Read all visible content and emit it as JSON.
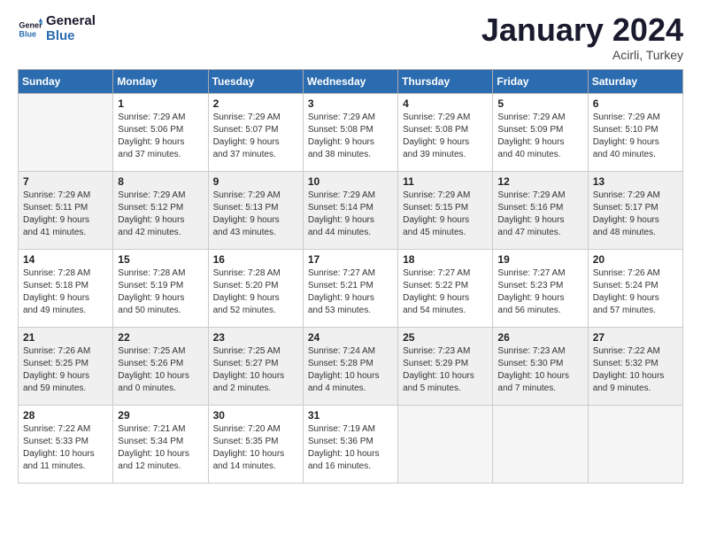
{
  "logo": {
    "text_general": "General",
    "text_blue": "Blue"
  },
  "header": {
    "month": "January 2024",
    "location": "Acirli, Turkey"
  },
  "weekdays": [
    "Sunday",
    "Monday",
    "Tuesday",
    "Wednesday",
    "Thursday",
    "Friday",
    "Saturday"
  ],
  "weeks": [
    [
      {
        "day": null,
        "lines": []
      },
      {
        "day": "1",
        "lines": [
          "Sunrise: 7:29 AM",
          "Sunset: 5:06 PM",
          "Daylight: 9 hours",
          "and 37 minutes."
        ]
      },
      {
        "day": "2",
        "lines": [
          "Sunrise: 7:29 AM",
          "Sunset: 5:07 PM",
          "Daylight: 9 hours",
          "and 37 minutes."
        ]
      },
      {
        "day": "3",
        "lines": [
          "Sunrise: 7:29 AM",
          "Sunset: 5:08 PM",
          "Daylight: 9 hours",
          "and 38 minutes."
        ]
      },
      {
        "day": "4",
        "lines": [
          "Sunrise: 7:29 AM",
          "Sunset: 5:08 PM",
          "Daylight: 9 hours",
          "and 39 minutes."
        ]
      },
      {
        "day": "5",
        "lines": [
          "Sunrise: 7:29 AM",
          "Sunset: 5:09 PM",
          "Daylight: 9 hours",
          "and 40 minutes."
        ]
      },
      {
        "day": "6",
        "lines": [
          "Sunrise: 7:29 AM",
          "Sunset: 5:10 PM",
          "Daylight: 9 hours",
          "and 40 minutes."
        ]
      }
    ],
    [
      {
        "day": "7",
        "lines": [
          "Sunrise: 7:29 AM",
          "Sunset: 5:11 PM",
          "Daylight: 9 hours",
          "and 41 minutes."
        ]
      },
      {
        "day": "8",
        "lines": [
          "Sunrise: 7:29 AM",
          "Sunset: 5:12 PM",
          "Daylight: 9 hours",
          "and 42 minutes."
        ]
      },
      {
        "day": "9",
        "lines": [
          "Sunrise: 7:29 AM",
          "Sunset: 5:13 PM",
          "Daylight: 9 hours",
          "and 43 minutes."
        ]
      },
      {
        "day": "10",
        "lines": [
          "Sunrise: 7:29 AM",
          "Sunset: 5:14 PM",
          "Daylight: 9 hours",
          "and 44 minutes."
        ]
      },
      {
        "day": "11",
        "lines": [
          "Sunrise: 7:29 AM",
          "Sunset: 5:15 PM",
          "Daylight: 9 hours",
          "and 45 minutes."
        ]
      },
      {
        "day": "12",
        "lines": [
          "Sunrise: 7:29 AM",
          "Sunset: 5:16 PM",
          "Daylight: 9 hours",
          "and 47 minutes."
        ]
      },
      {
        "day": "13",
        "lines": [
          "Sunrise: 7:29 AM",
          "Sunset: 5:17 PM",
          "Daylight: 9 hours",
          "and 48 minutes."
        ]
      }
    ],
    [
      {
        "day": "14",
        "lines": [
          "Sunrise: 7:28 AM",
          "Sunset: 5:18 PM",
          "Daylight: 9 hours",
          "and 49 minutes."
        ]
      },
      {
        "day": "15",
        "lines": [
          "Sunrise: 7:28 AM",
          "Sunset: 5:19 PM",
          "Daylight: 9 hours",
          "and 50 minutes."
        ]
      },
      {
        "day": "16",
        "lines": [
          "Sunrise: 7:28 AM",
          "Sunset: 5:20 PM",
          "Daylight: 9 hours",
          "and 52 minutes."
        ]
      },
      {
        "day": "17",
        "lines": [
          "Sunrise: 7:27 AM",
          "Sunset: 5:21 PM",
          "Daylight: 9 hours",
          "and 53 minutes."
        ]
      },
      {
        "day": "18",
        "lines": [
          "Sunrise: 7:27 AM",
          "Sunset: 5:22 PM",
          "Daylight: 9 hours",
          "and 54 minutes."
        ]
      },
      {
        "day": "19",
        "lines": [
          "Sunrise: 7:27 AM",
          "Sunset: 5:23 PM",
          "Daylight: 9 hours",
          "and 56 minutes."
        ]
      },
      {
        "day": "20",
        "lines": [
          "Sunrise: 7:26 AM",
          "Sunset: 5:24 PM",
          "Daylight: 9 hours",
          "and 57 minutes."
        ]
      }
    ],
    [
      {
        "day": "21",
        "lines": [
          "Sunrise: 7:26 AM",
          "Sunset: 5:25 PM",
          "Daylight: 9 hours",
          "and 59 minutes."
        ]
      },
      {
        "day": "22",
        "lines": [
          "Sunrise: 7:25 AM",
          "Sunset: 5:26 PM",
          "Daylight: 10 hours",
          "and 0 minutes."
        ]
      },
      {
        "day": "23",
        "lines": [
          "Sunrise: 7:25 AM",
          "Sunset: 5:27 PM",
          "Daylight: 10 hours",
          "and 2 minutes."
        ]
      },
      {
        "day": "24",
        "lines": [
          "Sunrise: 7:24 AM",
          "Sunset: 5:28 PM",
          "Daylight: 10 hours",
          "and 4 minutes."
        ]
      },
      {
        "day": "25",
        "lines": [
          "Sunrise: 7:23 AM",
          "Sunset: 5:29 PM",
          "Daylight: 10 hours",
          "and 5 minutes."
        ]
      },
      {
        "day": "26",
        "lines": [
          "Sunrise: 7:23 AM",
          "Sunset: 5:30 PM",
          "Daylight: 10 hours",
          "and 7 minutes."
        ]
      },
      {
        "day": "27",
        "lines": [
          "Sunrise: 7:22 AM",
          "Sunset: 5:32 PM",
          "Daylight: 10 hours",
          "and 9 minutes."
        ]
      }
    ],
    [
      {
        "day": "28",
        "lines": [
          "Sunrise: 7:22 AM",
          "Sunset: 5:33 PM",
          "Daylight: 10 hours",
          "and 11 minutes."
        ]
      },
      {
        "day": "29",
        "lines": [
          "Sunrise: 7:21 AM",
          "Sunset: 5:34 PM",
          "Daylight: 10 hours",
          "and 12 minutes."
        ]
      },
      {
        "day": "30",
        "lines": [
          "Sunrise: 7:20 AM",
          "Sunset: 5:35 PM",
          "Daylight: 10 hours",
          "and 14 minutes."
        ]
      },
      {
        "day": "31",
        "lines": [
          "Sunrise: 7:19 AM",
          "Sunset: 5:36 PM",
          "Daylight: 10 hours",
          "and 16 minutes."
        ]
      },
      {
        "day": null,
        "lines": []
      },
      {
        "day": null,
        "lines": []
      },
      {
        "day": null,
        "lines": []
      }
    ]
  ]
}
